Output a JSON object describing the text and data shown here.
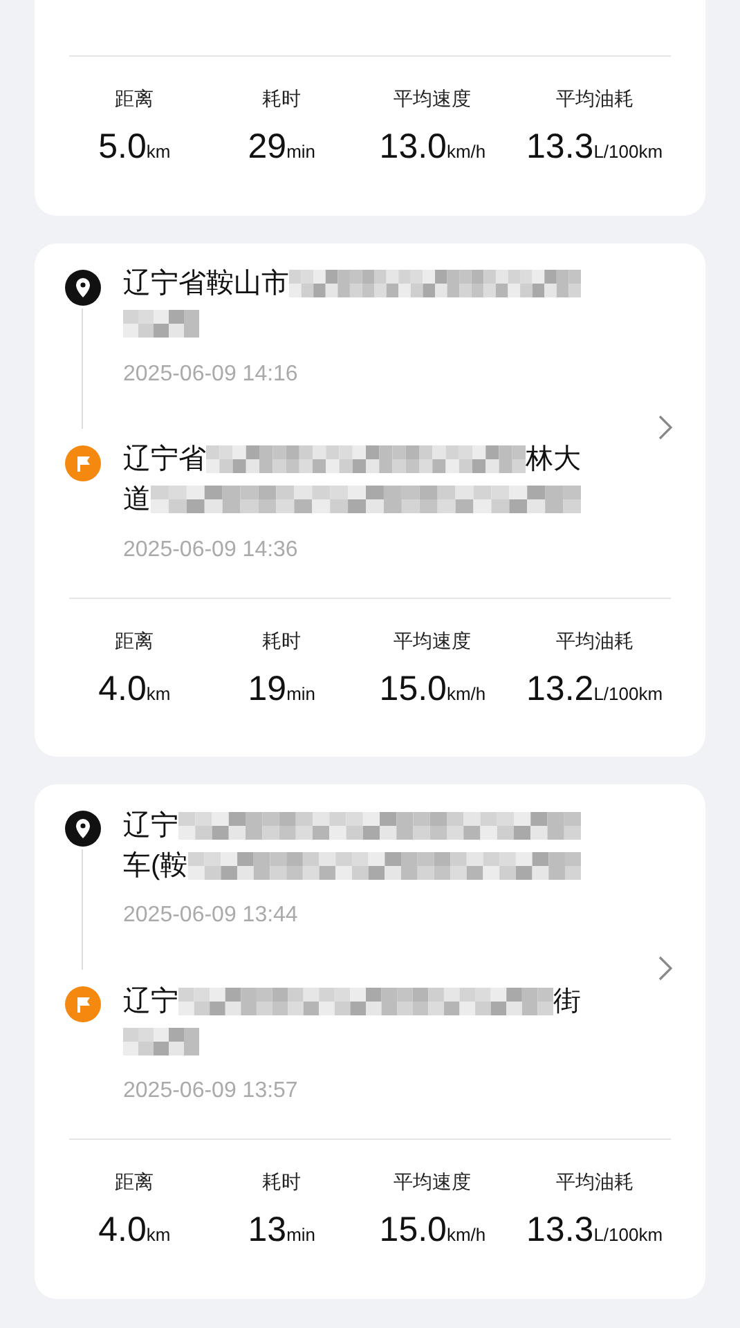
{
  "trips": [
    {
      "partial": true,
      "stats": [
        {
          "label": "距离",
          "value": "5.0",
          "unit": "km"
        },
        {
          "label": "耗时",
          "value": "29",
          "unit": "min"
        },
        {
          "label": "平均速度",
          "value": "13.0",
          "unit": "km/h"
        },
        {
          "label": "平均油耗",
          "value": "13.3",
          "unit": "L/100km"
        }
      ]
    },
    {
      "partial": false,
      "start": {
        "lines": [
          [
            {
              "kind": "text",
              "text": "辽宁省鞍山市"
            },
            {
              "kind": "mosaic"
            }
          ],
          [
            {
              "kind": "mosaic_short"
            }
          ]
        ],
        "time": "2025-06-09 14:16"
      },
      "end": {
        "lines": [
          [
            {
              "kind": "text",
              "text": "辽宁省"
            },
            {
              "kind": "mosaic"
            },
            {
              "kind": "text",
              "text": "林大"
            }
          ],
          [
            {
              "kind": "text",
              "text": "道"
            },
            {
              "kind": "mosaic"
            }
          ]
        ],
        "time": "2025-06-09 14:36"
      },
      "stats": [
        {
          "label": "距离",
          "value": "4.0",
          "unit": "km"
        },
        {
          "label": "耗时",
          "value": "19",
          "unit": "min"
        },
        {
          "label": "平均速度",
          "value": "15.0",
          "unit": "km/h"
        },
        {
          "label": "平均油耗",
          "value": "13.2",
          "unit": "L/100km"
        }
      ]
    },
    {
      "partial": false,
      "start": {
        "lines": [
          [
            {
              "kind": "text",
              "text": "辽宁"
            },
            {
              "kind": "mosaic"
            }
          ],
          [
            {
              "kind": "text",
              "text": "车(鞍"
            },
            {
              "kind": "mosaic"
            }
          ]
        ],
        "time": "2025-06-09 13:44"
      },
      "end": {
        "lines": [
          [
            {
              "kind": "text",
              "text": "辽宁"
            },
            {
              "kind": "mosaic"
            },
            {
              "kind": "text",
              "text": "街"
            }
          ],
          [
            {
              "kind": "mosaic_short"
            }
          ]
        ],
        "time": "2025-06-09 13:57"
      },
      "stats": [
        {
          "label": "距离",
          "value": "4.0",
          "unit": "km"
        },
        {
          "label": "耗时",
          "value": "13",
          "unit": "min"
        },
        {
          "label": "平均速度",
          "value": "15.0",
          "unit": "km/h"
        },
        {
          "label": "平均油耗",
          "value": "13.3",
          "unit": "L/100km"
        }
      ]
    }
  ]
}
